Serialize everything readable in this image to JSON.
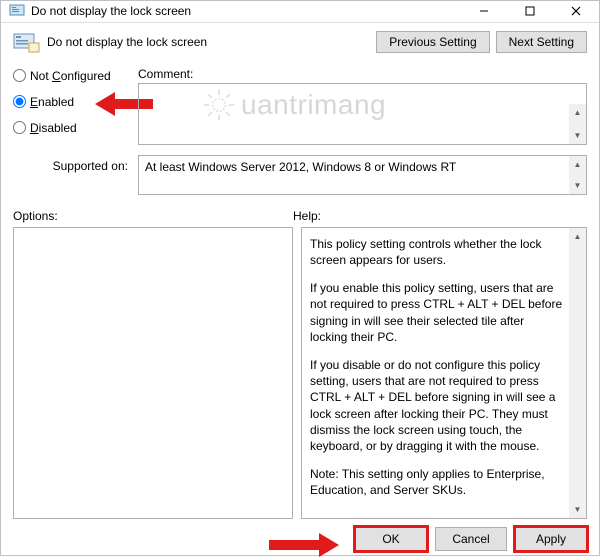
{
  "window": {
    "title": "Do not display the lock screen"
  },
  "header": {
    "title": "Do not display the lock screen",
    "prev": "Previous Setting",
    "next": "Next Setting"
  },
  "radios": {
    "not_configured": "Not Configured",
    "enabled": "Enabled",
    "disabled": "Disabled",
    "selected": "enabled"
  },
  "labels": {
    "comment": "Comment:",
    "supported": "Supported on:",
    "options": "Options:",
    "help": "Help:"
  },
  "comment": "",
  "supported_on": "At least Windows Server 2012, Windows 8 or Windows RT",
  "help": {
    "p1": "This policy setting controls whether the lock screen appears for users.",
    "p2": "If you enable this policy setting, users that are not required to press CTRL + ALT + DEL before signing in will see their selected tile after locking their PC.",
    "p3": "If you disable or do not configure this policy setting, users that are not required to press CTRL + ALT + DEL before signing in will see a lock screen after locking their PC. They must dismiss the lock screen using touch, the keyboard, or by dragging it with the mouse.",
    "p4": "Note: This setting only applies to Enterprise, Education, and Server SKUs."
  },
  "buttons": {
    "ok": "OK",
    "cancel": "Cancel",
    "apply": "Apply"
  },
  "watermark": "uantrimang"
}
